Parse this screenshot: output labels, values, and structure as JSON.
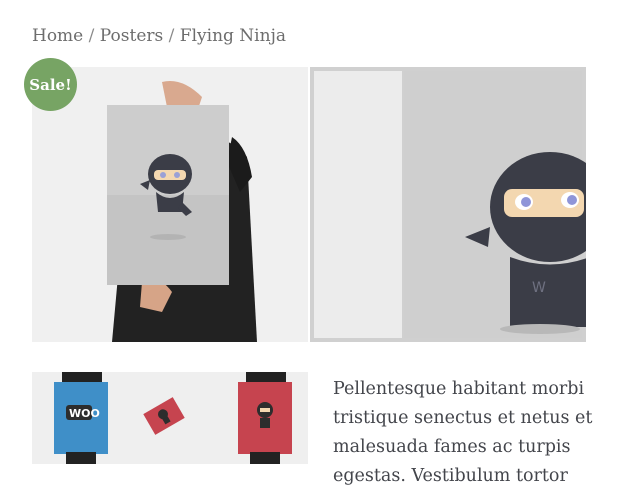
{
  "breadcrumb": {
    "home": "Home",
    "sep": "/",
    "category": "Posters",
    "current": "Flying Ninja"
  },
  "badge": {
    "label": "Sale!",
    "color": "#77a464"
  },
  "thumbnail": {
    "woo_text": "WOO"
  },
  "description": {
    "text": "Pellentesque habitant morbi tristique senectus et netus et malesuada fames ac turpis egestas. Vestibulum tortor"
  },
  "colors": {
    "poster_blue": "#3f8fc8",
    "poster_red": "#c6444f",
    "ninja_body": "#3b3d47"
  }
}
